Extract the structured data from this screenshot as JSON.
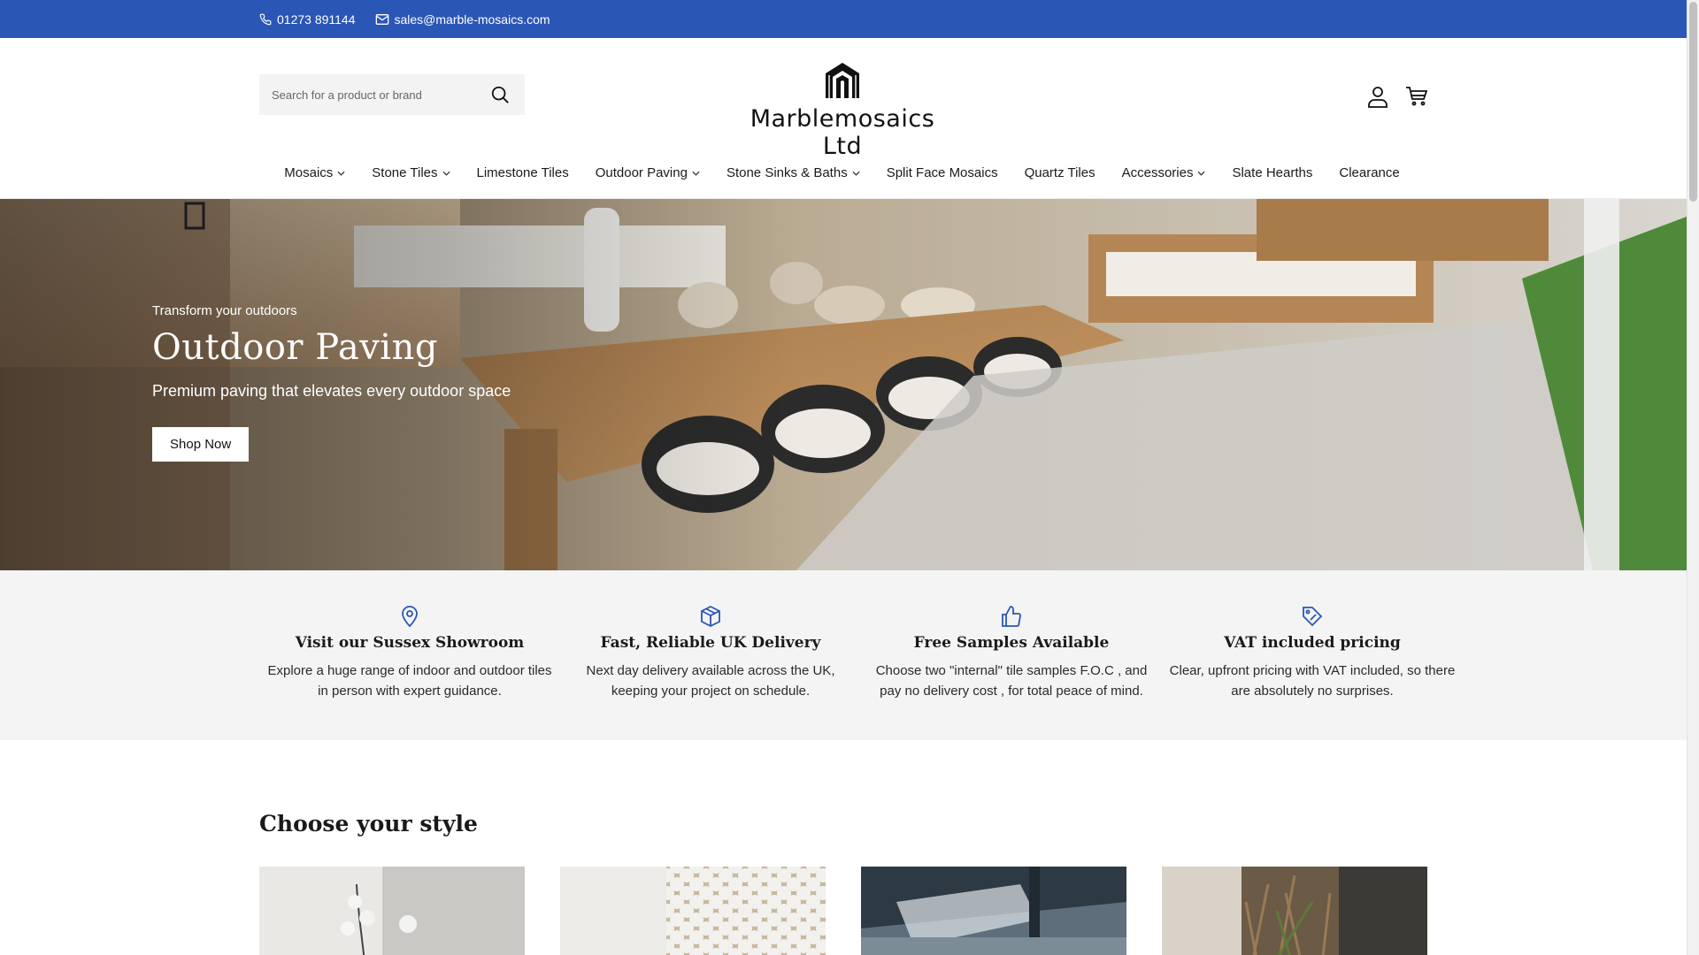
{
  "topbar": {
    "phone": "01273 891144",
    "email": "sales@marble-mosaics.com",
    "background": "#2a56b6"
  },
  "header": {
    "search_placeholder": "Search for a product or brand",
    "logo_text": "Marblemosaics Ltd",
    "icons": [
      "search-icon",
      "account-icon",
      "cart-icon"
    ]
  },
  "nav": {
    "items": [
      {
        "label": "Mosaics",
        "dropdown": true
      },
      {
        "label": "Stone Tiles",
        "dropdown": true
      },
      {
        "label": "Limestone Tiles",
        "dropdown": false
      },
      {
        "label": "Outdoor Paving",
        "dropdown": true
      },
      {
        "label": "Stone Sinks & Baths",
        "dropdown": true
      },
      {
        "label": "Split Face Mosaics",
        "dropdown": false
      },
      {
        "label": "Quartz Tiles",
        "dropdown": false
      },
      {
        "label": "Accessories",
        "dropdown": true
      },
      {
        "label": "Slate Hearths",
        "dropdown": false
      },
      {
        "label": "Clearance",
        "dropdown": false
      }
    ]
  },
  "hero": {
    "eyebrow": "Transform your outdoors",
    "title": "Outdoor Paving",
    "subtitle": "Premium paving that elevates every outdoor space",
    "button_label": "Shop Now"
  },
  "features": [
    {
      "icon": "map-pin-icon",
      "title": "Visit our Sussex Showroom",
      "text": "Explore a huge range of indoor and outdoor tiles in person with expert guidance."
    },
    {
      "icon": "box-icon",
      "title": "Fast, Reliable UK Delivery",
      "text": "Next day delivery available across the UK, keeping your project on schedule."
    },
    {
      "icon": "thumbs-up-icon",
      "title": "Free Samples Available",
      "text": "Choose two \"internal\" tile samples F.O.C , and pay no delivery cost , for total peace of mind."
    },
    {
      "icon": "price-tag-icon",
      "title": "VAT included pricing",
      "text": "Clear, upfront pricing with VAT included, so there are absolutely no surprises."
    }
  ],
  "style_section": {
    "title": "Choose your style"
  },
  "colors": {
    "accent": "#2a56b6",
    "feature_bg": "#f4f4f4"
  }
}
